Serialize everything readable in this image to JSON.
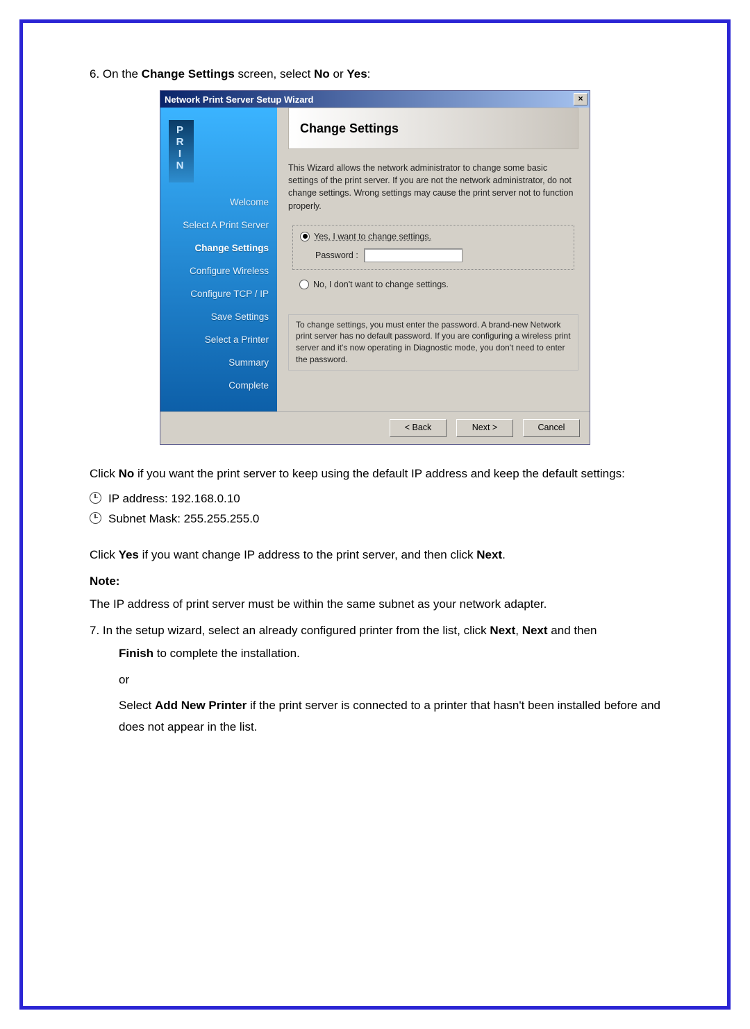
{
  "step6_intro": {
    "prefix": "6. On the ",
    "bold1": "Change Settings",
    "mid": " screen, select ",
    "boldNo": "No",
    "or": " or ",
    "boldYes": "Yes",
    "suffix": ":"
  },
  "wizard": {
    "title": "Network Print Server Setup Wizard",
    "brand_vertical": "PRIN",
    "steps": [
      "Welcome",
      "Select A Print Server",
      "Change Settings",
      "Configure Wireless",
      "Configure TCP / IP",
      "Save Settings",
      "Select a Printer",
      "Summary",
      "Complete"
    ],
    "active_step_index": 2,
    "heading": "Change Settings",
    "desc": "This Wizard allows the network administrator to change some basic settings of the print server. If you are not the network administrator, do not change settings. Wrong settings may cause the print server not to function properly.",
    "opt_yes": "Yes, I want to change settings.",
    "pw_label": "Password :",
    "opt_no": "No, I don't want to change settings.",
    "note": "To change settings, you must enter the password. A brand-new Network print server has no default password. If you are configuring a wireless print server and it's now operating in Diagnostic mode, you don't need to enter the password.",
    "btn_back": "< Back",
    "btn_next": "Next >",
    "btn_cancel": "Cancel"
  },
  "post": {
    "clickNo": {
      "pfx": "Click ",
      "bold": "No",
      "rest": " if you want the print server to keep using the default IP address and keep the default settings:"
    },
    "bullets": [
      "IP address: 192.168.0.10",
      "Subnet Mask: 255.255.255.0"
    ],
    "clickYes": {
      "pfx": "Click ",
      "b1": "Yes",
      "mid": " if you want change IP address to the print server, and then click ",
      "b2": "Next",
      "end": "."
    },
    "noteLabel": "Note:",
    "noteBody": "The IP address of print server must be within the same subnet as your network adapter.",
    "step7": {
      "pfx": "7. In the setup wizard, select an already configured printer from the list, click ",
      "bNext1": "Next",
      "c1": ", ",
      "bNext2": "Next",
      "mid2": " and then ",
      "bFinish": "Finish",
      "mid3": " to complete the installation.",
      "or": "or",
      "sel1": "Select ",
      "bAdd": "Add New Printer",
      "sel2": " if the print server is connected to a printer that hasn't been installed before and does not appear in the list."
    }
  }
}
